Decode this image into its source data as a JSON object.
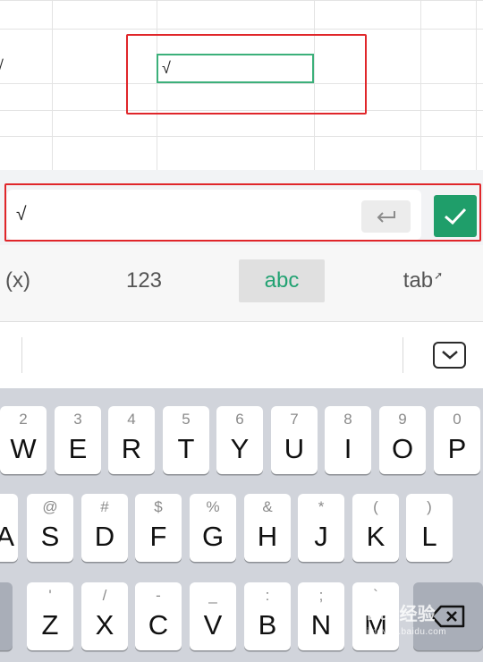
{
  "sheet": {
    "left_cell_value": "√",
    "active_cell_value": "√"
  },
  "formula_bar": {
    "value": "√",
    "enter_icon": "return-arrow-icon",
    "confirm_icon": "checkmark-icon",
    "accent_color": "#1f9e6a"
  },
  "mode_tabs": [
    {
      "label": "(x)"
    },
    {
      "label": "123"
    },
    {
      "label": "abc",
      "selected": true
    },
    {
      "label": "tab"
    }
  ],
  "suggest_bar": {
    "hide_keyboard_icon": "keyboard-collapse-icon"
  },
  "keyboard": {
    "row1": [
      {
        "alt": "2",
        "main": "W"
      },
      {
        "alt": "3",
        "main": "E"
      },
      {
        "alt": "4",
        "main": "R"
      },
      {
        "alt": "5",
        "main": "T"
      },
      {
        "alt": "6",
        "main": "Y"
      },
      {
        "alt": "7",
        "main": "U"
      },
      {
        "alt": "8",
        "main": "I"
      },
      {
        "alt": "9",
        "main": "O"
      },
      {
        "alt": "0",
        "main": "P"
      }
    ],
    "row2_partial": {
      "main": "A"
    },
    "row2": [
      {
        "alt": "@",
        "main": "S"
      },
      {
        "alt": "#",
        "main": "D"
      },
      {
        "alt": "$",
        "main": "F"
      },
      {
        "alt": "%",
        "main": "G"
      },
      {
        "alt": "&",
        "main": "H"
      },
      {
        "alt": "*",
        "main": "J"
      },
      {
        "alt": "(",
        "main": "K"
      },
      {
        "alt": ")",
        "main": "L"
      }
    ],
    "row3": [
      {
        "alt": "'",
        "main": "Z"
      },
      {
        "alt": "/",
        "main": "X"
      },
      {
        "alt": "-",
        "main": "C"
      },
      {
        "alt": "_",
        "main": "V"
      },
      {
        "alt": ":",
        "main": "B"
      },
      {
        "alt": ";",
        "main": "N"
      },
      {
        "alt": "`",
        "main": "M"
      }
    ],
    "delete_icon": "backspace-icon"
  },
  "watermark": {
    "brand": "Bai 经验",
    "url": "jingyan.baidu.com"
  }
}
